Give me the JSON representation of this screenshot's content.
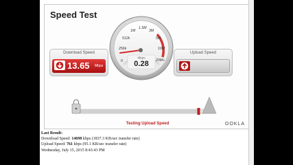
{
  "app": {
    "title": "Speed Test"
  },
  "download": {
    "label": "Download Speed",
    "value": "13.65",
    "unit": "Mbps"
  },
  "upload": {
    "label": "Upload Speed",
    "value": ""
  },
  "gauge": {
    "ticks": [
      "0",
      "256k",
      "512k",
      "1M",
      "1.5M",
      "3M",
      "5M",
      "10M",
      "20M+"
    ],
    "unit": "Mbps",
    "reading": "0.28",
    "needle_value_mbps": 0.28
  },
  "status": {
    "text": "Testing Upload Speed",
    "brand": "OOKLA"
  },
  "progress": {
    "fraction": 0.88
  },
  "last_result": {
    "heading": "Last Result:",
    "download_prefix": "Download Speed: ",
    "download_value": "14698",
    "download_suffix": " kbps (1837.3 KB/sec transfer rate)",
    "upload_prefix": "Upload Speed: ",
    "upload_value": "761",
    "upload_suffix": " kbps (95.1 KB/sec transfer rate)",
    "timestamp": "Wednesday, July 15, 2015 8:43:43 PM"
  },
  "colors": {
    "accent": "#c01f1f",
    "needle": "#d42a2a"
  }
}
